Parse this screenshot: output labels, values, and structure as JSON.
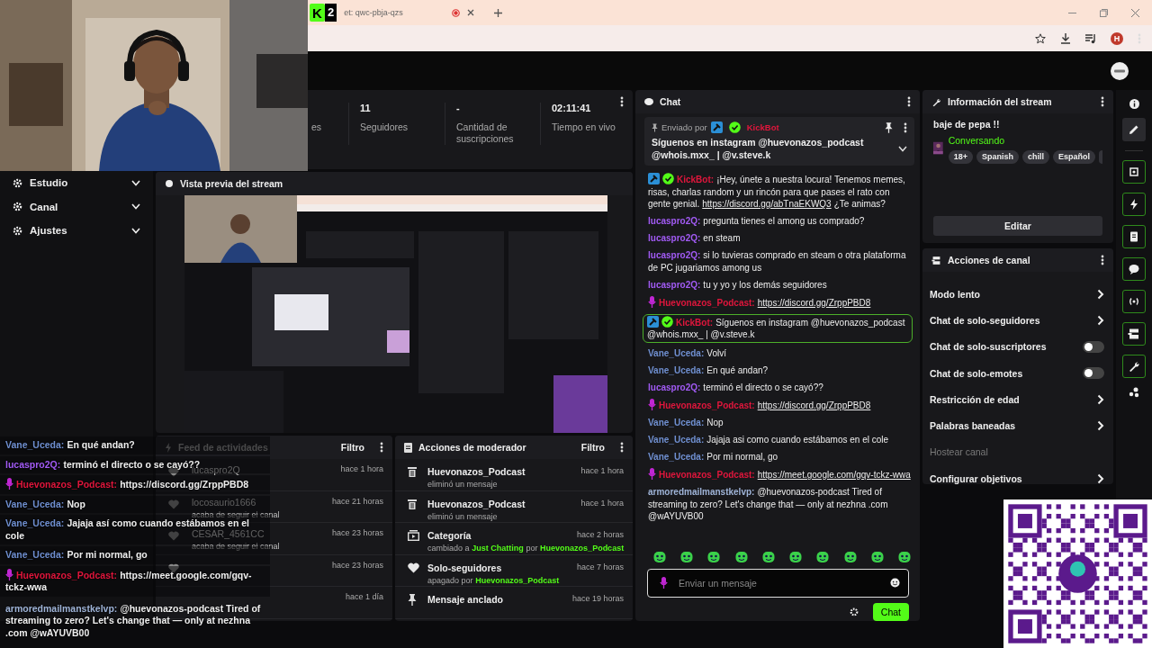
{
  "browser": {
    "app_logo": "K",
    "app_count": "2",
    "tab_title": "et: qwc-pbja-qzs",
    "profile_initial": "H"
  },
  "sidebar": {
    "items": [
      {
        "label": "Estudio",
        "expanded": false
      },
      {
        "label": "Canal",
        "expanded": false
      },
      {
        "label": "Ajustes",
        "expanded": false
      }
    ]
  },
  "stats": [
    {
      "label": "es"
    },
    {
      "value": "11",
      "label": "Seguidores"
    },
    {
      "value": "-",
      "label": "Cantidad de suscripciones"
    },
    {
      "value": "02:11:41",
      "label": "Tiempo en vivo"
    }
  ],
  "preview": {
    "title": "Vista previa del stream"
  },
  "activity_feed": {
    "title": "Feed de actividades",
    "filter": "Filtro",
    "items": [
      {
        "user": "lucaspro2Q",
        "time": "hace 1 hora"
      },
      {
        "user": "locosaurio1666",
        "detail": "acaba de seguir el canal",
        "time": "hace 21 horas"
      },
      {
        "user": "CESAR_4561CC",
        "detail": "acaba de seguir el canal",
        "time": "hace 23 horas"
      },
      {
        "time": "hace 23 horas"
      },
      {
        "time": "hace 1 día"
      }
    ]
  },
  "moderator_actions": {
    "title": "Acciones de moderador",
    "filter": "Filtro",
    "items": [
      {
        "kind": "trash",
        "title": "Huevonazos_Podcast",
        "detail": [
          {
            "text": "eliminó un mensaje",
            "highlight": false
          }
        ],
        "time": "hace 1 hora"
      },
      {
        "kind": "trash",
        "title": "Huevonazos_Podcast",
        "detail": [
          {
            "text": "eliminó un mensaje",
            "highlight": false
          }
        ],
        "time": "hace 1 hora"
      },
      {
        "kind": "category",
        "title": "Categoría",
        "detail": [
          {
            "text": "cambiado a",
            "highlight": false
          },
          {
            "text": "Just Chatting",
            "highlight": true
          },
          {
            "text": "por",
            "highlight": false
          },
          {
            "text": "Huevonazos_Podcast",
            "highlight": true
          }
        ],
        "time": "hace 2 horas"
      },
      {
        "kind": "heart",
        "title": "Solo-seguidores",
        "detail": [
          {
            "text": "apagado por",
            "highlight": false
          },
          {
            "text": "Huevonazos_Podcast",
            "highlight": true
          }
        ],
        "time": "hace 7 horas"
      },
      {
        "kind": "pin",
        "title": "Mensaje anclado",
        "time": "hace 19 horas"
      }
    ]
  },
  "chat": {
    "title": "Chat",
    "pinned": {
      "sent_by": "Enviado por",
      "user": "KickBot",
      "text": "Síguenos en instagram @huevonazos_podcast @whois.mxx_ | @v.steve.k"
    },
    "messages": [
      {
        "kind": "bot",
        "user": "KickBot:",
        "color": "#e0163c",
        "text": "¡Hey, únete a nuestra locura! Tenemos memes, risas, charlas random y un rincón para que pases el rato con gente genial.",
        "link": "https://discord.gg/abTnaEKWQ3",
        "after": "¿Te animas?",
        "highlighted": false
      },
      {
        "kind": "user",
        "user": "lucaspro2Q:",
        "color": "#a25bf5",
        "text": "pregunta tienes el among us comprado?",
        "highlighted": false
      },
      {
        "kind": "user",
        "user": "lucaspro2Q:",
        "color": "#a25bf5",
        "text": "en steam",
        "highlighted": false
      },
      {
        "kind": "user",
        "user": "lucaspro2Q:",
        "color": "#a25bf5",
        "text": "si lo tuvieras comprado en steam o otra plataforma de PC jugariamos among us",
        "highlighted": false
      },
      {
        "kind": "user",
        "user": "lucaspro2Q:",
        "color": "#a25bf5",
        "text": "tu y yo y los demás seguidores",
        "highlighted": false
      },
      {
        "kind": "host",
        "user": "Huevonazos_Podcast:",
        "color": "#e0163c",
        "link": "https://discord.gg/ZrppPBD8",
        "highlighted": false
      },
      {
        "kind": "bot",
        "user": "KickBot:",
        "color": "#e0163c",
        "text": "Síguenos en instagram @huevonazos_podcast @whois.mxx_ | @v.steve.k",
        "highlighted": true
      },
      {
        "kind": "user",
        "user": "Vane_Uceda:",
        "color": "#6f8fd0",
        "text": "Volví",
        "highlighted": false
      },
      {
        "kind": "user",
        "user": "Vane_Uceda:",
        "color": "#6f8fd0",
        "text": "En qué andan?",
        "highlighted": false
      },
      {
        "kind": "user",
        "user": "lucaspro2Q:",
        "color": "#a25bf5",
        "text": "terminó el directo o se cayó??",
        "highlighted": false
      },
      {
        "kind": "host",
        "user": "Huevonazos_Podcast:",
        "color": "#e0163c",
        "link": "https://discord.gg/ZrppPBD8",
        "highlighted": false
      },
      {
        "kind": "user",
        "user": "Vane_Uceda:",
        "color": "#6f8fd0",
        "text": "Nop",
        "highlighted": false
      },
      {
        "kind": "user",
        "user": "Vane_Uceda:",
        "color": "#6f8fd0",
        "text": "Jajaja asi como cuando estábamos en el cole",
        "highlighted": false
      },
      {
        "kind": "user",
        "user": "Vane_Uceda:",
        "color": "#6f8fd0",
        "text": "Por mi normal, go",
        "highlighted": false
      },
      {
        "kind": "host",
        "user": "Huevonazos_Podcast:",
        "color": "#e0163c",
        "link": "https://meet.google.com/gqv-tckz-wwa",
        "highlighted": false
      },
      {
        "kind": "user",
        "user": "armoredmailmanstkelvp:",
        "color": "#9fb4d8",
        "text": "@huevonazos-podcast Tired of streaming to zero? Let's change that — only at nezhna .com @wAYUVB00",
        "highlighted": false
      }
    ],
    "input_placeholder": "Enviar un mensaje",
    "send": "Chat"
  },
  "stream_info": {
    "title": "Información del stream",
    "stream_title": "baje de pepa !!",
    "category": "Conversando",
    "tags": [
      "18+",
      "Spanish",
      "chill",
      "Español"
    ],
    "edit": "Editar"
  },
  "channel_actions": {
    "title": "Acciones de canal",
    "items": [
      {
        "label": "Modo lento",
        "kind": "submenu"
      },
      {
        "label": "Chat de solo-seguidores",
        "kind": "submenu"
      },
      {
        "label": "Chat de solo-suscriptores",
        "kind": "toggle",
        "on": false
      },
      {
        "label": "Chat de solo-emotes",
        "kind": "toggle",
        "on": false
      },
      {
        "label": "Restricción de edad",
        "kind": "submenu"
      },
      {
        "label": "Palabras baneadas",
        "kind": "submenu"
      },
      {
        "label": "Hostear canal",
        "kind": "disabled"
      },
      {
        "label": "Configurar objetivos",
        "kind": "submenu"
      }
    ]
  },
  "overlay_chat": [
    {
      "kind": "user",
      "user": "Vane_Uceda:",
      "color": "#6f8fd0",
      "text": "En qué andan?"
    },
    {
      "kind": "user",
      "user": "lucaspro2Q:",
      "color": "#a25bf5",
      "text": "terminó el directo o se cayó??"
    },
    {
      "kind": "host",
      "user": "Huevonazos_Podcast:",
      "color": "#e0163c",
      "text": "https://discord.gg/ZrppPBD8"
    },
    {
      "kind": "user",
      "user": "Vane_Uceda:",
      "color": "#6f8fd0",
      "text": "Nop"
    },
    {
      "kind": "user",
      "user": "Vane_Uceda:",
      "color": "#6f8fd0",
      "text": "Jajaja así como cuando estábamos en el cole"
    },
    {
      "kind": "user",
      "user": "Vane_Uceda:",
      "color": "#6f8fd0",
      "text": "Por mi normal, go"
    },
    {
      "kind": "host",
      "user": "Huevonazos_Podcast:",
      "color": "#e0163c",
      "text": "https://meet.google.com/gqv-tckz-wwa"
    },
    {
      "kind": "user",
      "user": "armoredmailmanstkelvp:",
      "color": "#9fb4d8",
      "text": "@huevonazos-podcast Tired of streaming to zero? Let's change that — only at nezhna .com @wAYUVB00"
    }
  ]
}
